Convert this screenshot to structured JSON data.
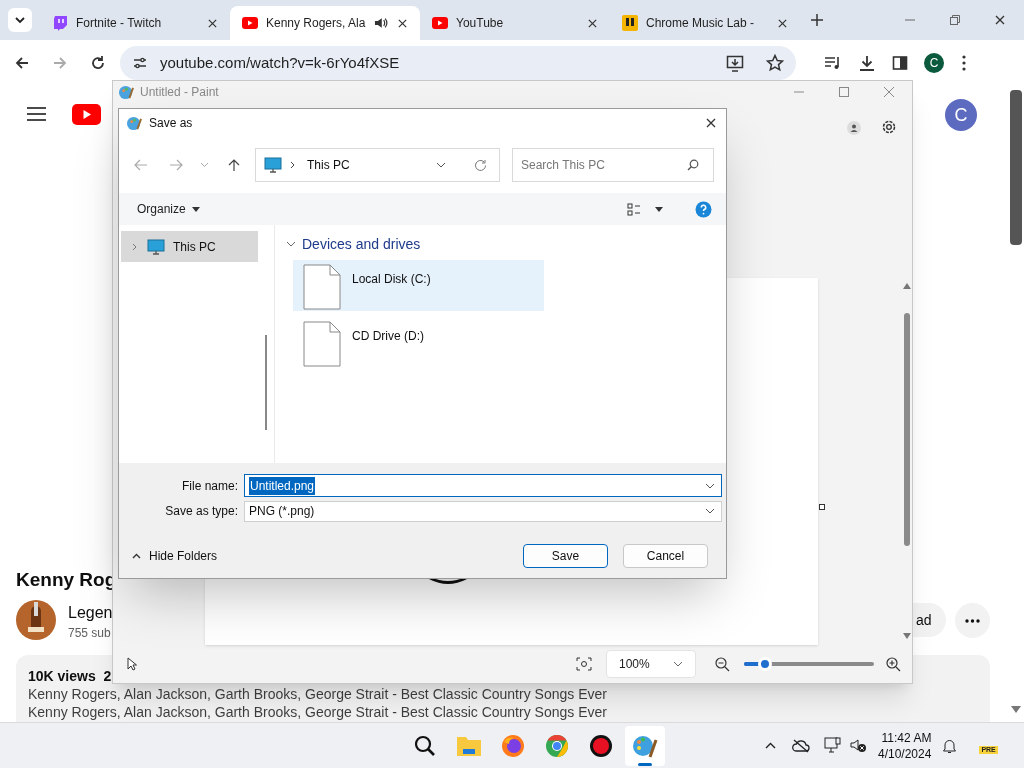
{
  "browser": {
    "tabs": [
      {
        "title": "Fortnite - Twitch",
        "kind": "twitch",
        "selected": false,
        "audio": false
      },
      {
        "title": "Kenny Rogers, Ala",
        "kind": "youtube",
        "selected": true,
        "audio": true
      },
      {
        "title": "YouTube",
        "kind": "youtube",
        "selected": false,
        "audio": false
      },
      {
        "title": "Chrome Music Lab -",
        "kind": "musiclab",
        "selected": false,
        "audio": false
      }
    ],
    "address": "youtube.com/watch?v=k-6rYo4fXSE",
    "profile_initial": "C"
  },
  "youtube": {
    "avatar_initial": "C",
    "video_title": "Kenny Rog",
    "channel_name": "Legen",
    "subscribers": "755 sub",
    "views": "10K views  2",
    "description_lines": [
      "Kenny Rogers, Alan Jackson, Garth Brooks, George Strait - Best Classic Country Songs Ever",
      "Kenny Rogers, Alan Jackson, Garth Brooks, George Strait - Best Classic Country Songs Ever"
    ],
    "download_label": "ad"
  },
  "paint": {
    "title": "Untitled - Paint",
    "zoom": "100%",
    "zoom_slider": {
      "level": 0.16
    }
  },
  "dialog": {
    "title": "Save as",
    "path": "This PC",
    "search_placeholder": "Search This PC",
    "organize": "Organize",
    "tree": [
      {
        "label": "This PC",
        "selected": true,
        "expanded": false
      }
    ],
    "groups": [
      {
        "label": "Devices and drives",
        "expanded": true,
        "items": [
          {
            "label": "Local Disk (C:)",
            "selected": true
          },
          {
            "label": "CD Drive (D:)",
            "selected": false
          }
        ]
      }
    ],
    "file_name_label": "File name:",
    "file_name": "Untitled.png",
    "file_name_selected": true,
    "type_label": "Save as type:",
    "type": "PNG (*.png)",
    "hide_folders": "Hide Folders",
    "buttons": [
      {
        "label": "Save",
        "kind": "primary"
      },
      {
        "label": "Cancel",
        "kind": "secondary"
      }
    ]
  },
  "taskbar": {
    "apps": [
      {
        "kind": "search",
        "active": false
      },
      {
        "kind": "files",
        "active": false
      },
      {
        "kind": "firefox",
        "active": false
      },
      {
        "kind": "chrome",
        "active": false
      },
      {
        "kind": "recorder",
        "active": false
      },
      {
        "kind": "paint",
        "active": true
      }
    ],
    "time": "11:42 AM",
    "date": "4/10/2024",
    "badge": "PRE"
  }
}
